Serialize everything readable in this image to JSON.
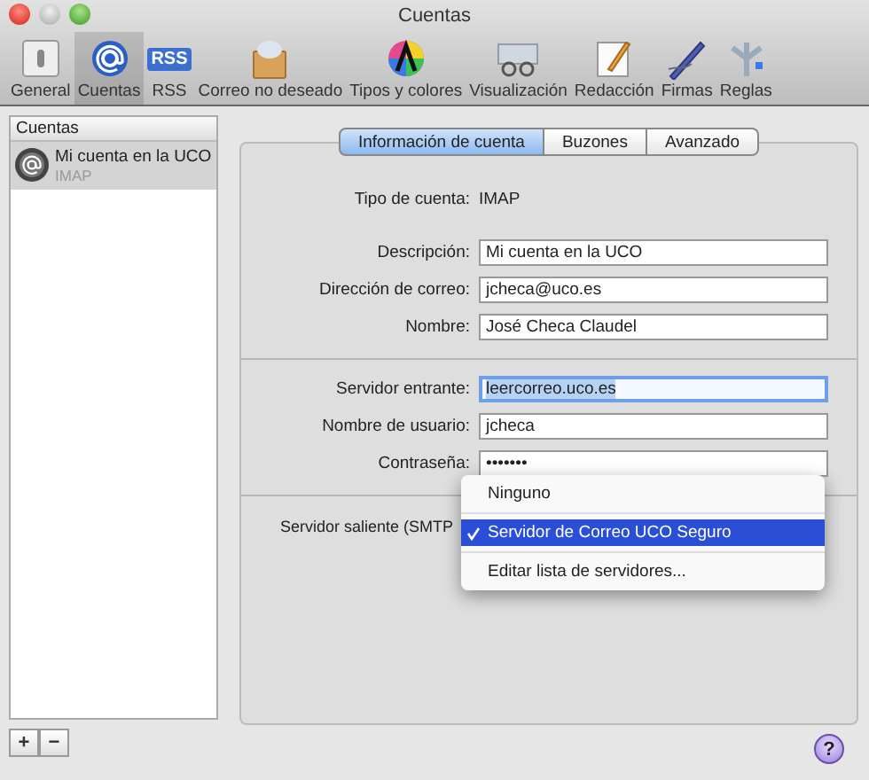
{
  "window": {
    "title": "Cuentas"
  },
  "toolbar": [
    {
      "label": "General",
      "selected": false
    },
    {
      "label": "Cuentas",
      "selected": true
    },
    {
      "label": "RSS",
      "selected": false
    },
    {
      "label": "Correo no deseado",
      "selected": false
    },
    {
      "label": "Tipos y colores",
      "selected": false
    },
    {
      "label": "Visualización",
      "selected": false
    },
    {
      "label": "Redacción",
      "selected": false
    },
    {
      "label": "Firmas",
      "selected": false
    },
    {
      "label": "Reglas",
      "selected": false
    }
  ],
  "rss_badge": "RSS",
  "sidebar": {
    "heading": "Cuentas",
    "accounts": [
      {
        "name": "Mi cuenta en la UCO",
        "type": "IMAP",
        "selected": true
      }
    ]
  },
  "tabs": [
    {
      "label": "Información de cuenta",
      "selected": true
    },
    {
      "label": "Buzones",
      "selected": false
    },
    {
      "label": "Avanzado",
      "selected": false
    }
  ],
  "account_type": {
    "label": "Tipo de cuenta:",
    "value": "IMAP"
  },
  "sections": [
    {
      "fields": [
        {
          "label": "Descripción:",
          "value": "Mi cuenta en la UCO",
          "focused": false
        },
        {
          "label": "Dirección de correo:",
          "value": "jcheca@uco.es",
          "focused": false
        },
        {
          "label": "Nombre:",
          "value": "José Checa Claudel",
          "focused": false
        }
      ]
    },
    {
      "fields": [
        {
          "label": "Servidor entrante:",
          "value": "leercorreo.uco.es",
          "focused": true
        },
        {
          "label": "Nombre de usuario:",
          "value": "jcheca",
          "focused": false
        },
        {
          "label": "Contraseña:",
          "value": "•••••••",
          "focused": false
        }
      ]
    }
  ],
  "outgoing": {
    "label": "Servidor saliente (SMTP"
  },
  "menu": [
    {
      "kind": "item",
      "label": "Ninguno",
      "selected": false
    },
    {
      "kind": "separator"
    },
    {
      "kind": "item",
      "label": "Servidor de Correo UCO Seguro",
      "selected": true
    },
    {
      "kind": "separator"
    },
    {
      "kind": "item",
      "label": "Editar lista de servidores...",
      "selected": false
    }
  ],
  "bottom_buttons": [
    "+",
    "−"
  ],
  "help": "?"
}
